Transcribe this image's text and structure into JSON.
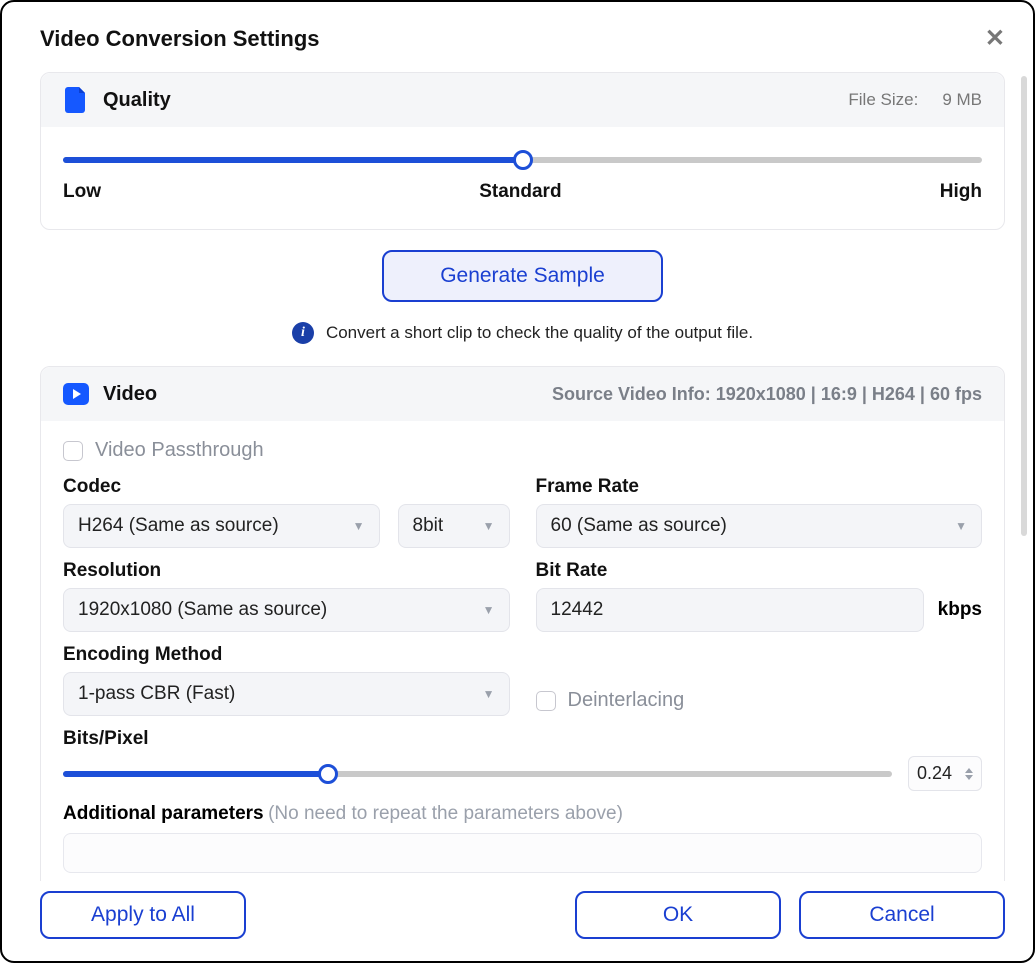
{
  "dialog": {
    "title": "Video Conversion Settings"
  },
  "quality": {
    "section_title": "Quality",
    "file_size_label": "File Size:",
    "file_size_value": "9 MB",
    "slider": {
      "low": "Low",
      "mid": "Standard",
      "high": "High",
      "percent": 50
    },
    "sample_button": "Generate Sample",
    "hint": "Convert a short clip to check the quality of the output file."
  },
  "video": {
    "section_title": "Video",
    "source_info": "Source Video Info: 1920x1080 | 16:9 | H264 | 60 fps",
    "passthrough_label": "Video Passthrough",
    "codec": {
      "label": "Codec",
      "value": "H264 (Same as source)",
      "bitdepth": "8bit"
    },
    "frame_rate": {
      "label": "Frame Rate",
      "value": "60 (Same as source)"
    },
    "resolution": {
      "label": "Resolution",
      "value": "1920x1080 (Same as source)"
    },
    "bit_rate": {
      "label": "Bit Rate",
      "value": "12442",
      "unit": "kbps"
    },
    "encoding": {
      "label": "Encoding Method",
      "value": "1-pass CBR (Fast)"
    },
    "deinterlacing_label": "Deinterlacing",
    "bits_pixel": {
      "label": "Bits/Pixel",
      "value": "0.24",
      "percent": 32
    },
    "additional": {
      "label": "Additional parameters",
      "hint": "(No need to repeat the parameters above)"
    }
  },
  "footer": {
    "apply_all": "Apply to All",
    "ok": "OK",
    "cancel": "Cancel"
  }
}
